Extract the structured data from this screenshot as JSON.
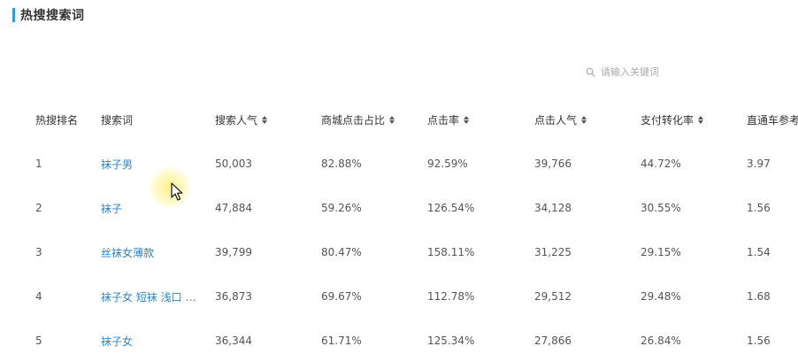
{
  "section": {
    "title": "热搜搜索词"
  },
  "search": {
    "placeholder": "请输入关键词",
    "icon": "search-icon"
  },
  "table": {
    "columns": [
      {
        "label": "热搜排名",
        "sortable": false
      },
      {
        "label": "搜索词",
        "sortable": false
      },
      {
        "label": "搜索人气",
        "sortable": true
      },
      {
        "label": "商城点击占比",
        "sortable": true
      },
      {
        "label": "点击率",
        "sortable": true
      },
      {
        "label": "点击人气",
        "sortable": true
      },
      {
        "label": "支付转化率",
        "sortable": true
      },
      {
        "label": "直通车参考价",
        "sortable": true
      }
    ],
    "rows": [
      {
        "rank": "1",
        "keyword": "袜子男",
        "search_popularity": "50,003",
        "mall_click_ratio": "82.88%",
        "click_rate": "92.59%",
        "click_popularity": "39,766",
        "pay_conversion": "44.72%",
        "ztc_price": "3.97"
      },
      {
        "rank": "2",
        "keyword": "袜子",
        "search_popularity": "47,884",
        "mall_click_ratio": "59.26%",
        "click_rate": "126.54%",
        "click_popularity": "34,128",
        "pay_conversion": "30.55%",
        "ztc_price": "1.56"
      },
      {
        "rank": "3",
        "keyword": "丝袜女薄款",
        "search_popularity": "39,799",
        "mall_click_ratio": "80.47%",
        "click_rate": "158.11%",
        "click_popularity": "31,225",
        "pay_conversion": "29.15%",
        "ztc_price": "1.54"
      },
      {
        "rank": "4",
        "keyword": "袜子女 短袜 浅口 韩...",
        "search_popularity": "36,873",
        "mall_click_ratio": "69.67%",
        "click_rate": "112.78%",
        "click_popularity": "29,512",
        "pay_conversion": "29.48%",
        "ztc_price": "1.68"
      },
      {
        "rank": "5",
        "keyword": "袜子女",
        "search_popularity": "36,344",
        "mall_click_ratio": "61.71%",
        "click_rate": "125.34%",
        "click_popularity": "27,866",
        "pay_conversion": "26.84%",
        "ztc_price": "1.56"
      }
    ]
  },
  "colors": {
    "accent": "#2b9fe0",
    "link": "#2b86c8",
    "text": "#333333",
    "muted": "#aaaaaa",
    "cursor_highlight": "#fff078"
  }
}
